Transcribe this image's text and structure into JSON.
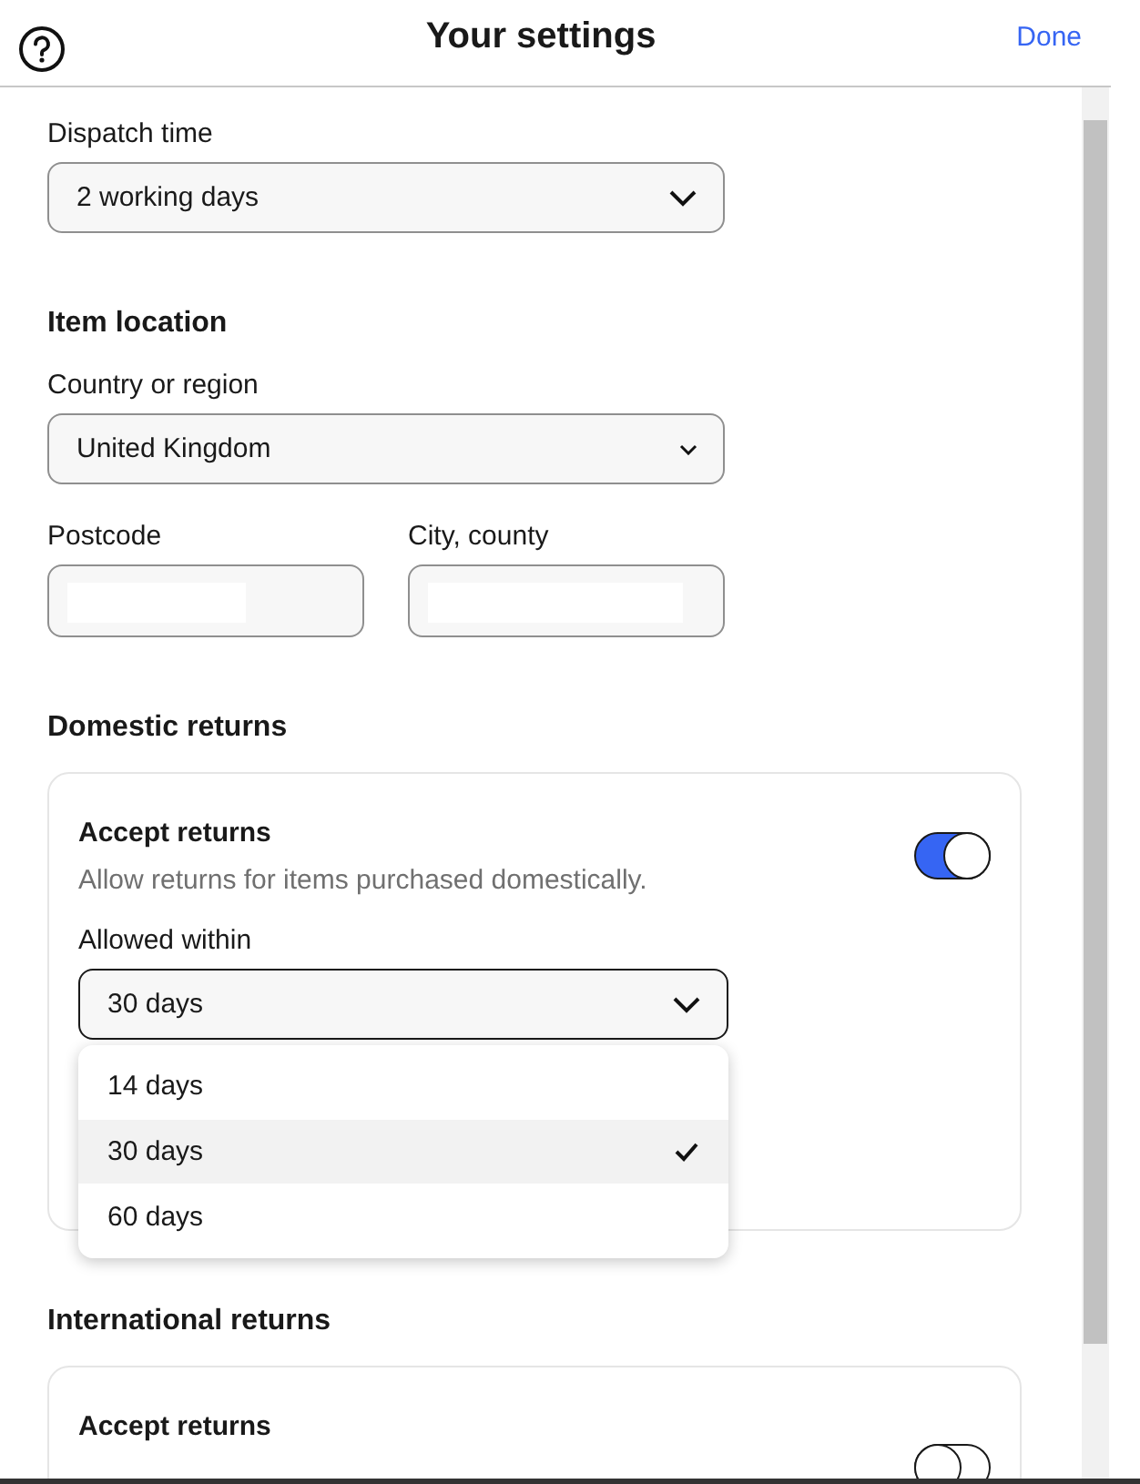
{
  "header": {
    "title": "Your settings",
    "done": "Done"
  },
  "dispatch": {
    "label": "Dispatch time",
    "value": "2 working days"
  },
  "item_location": {
    "heading": "Item location",
    "country": {
      "label": "Country or region",
      "value": "United Kingdom"
    },
    "postcode": {
      "label": "Postcode"
    },
    "city": {
      "label": "City, county"
    }
  },
  "domestic_returns": {
    "heading": "Domestic returns",
    "accept": {
      "label": "Accept returns",
      "description": "Allow returns for items purchased domestically.",
      "on": true
    },
    "allowed_within": {
      "label": "Allowed within",
      "value": "30 days",
      "expanded": true,
      "options": [
        {
          "label": "14 days",
          "selected": false
        },
        {
          "label": "30 days",
          "selected": true
        },
        {
          "label": "60 days",
          "selected": false
        }
      ]
    }
  },
  "international_returns": {
    "heading": "International returns",
    "accept": {
      "label": "Accept returns",
      "on": false
    }
  }
}
